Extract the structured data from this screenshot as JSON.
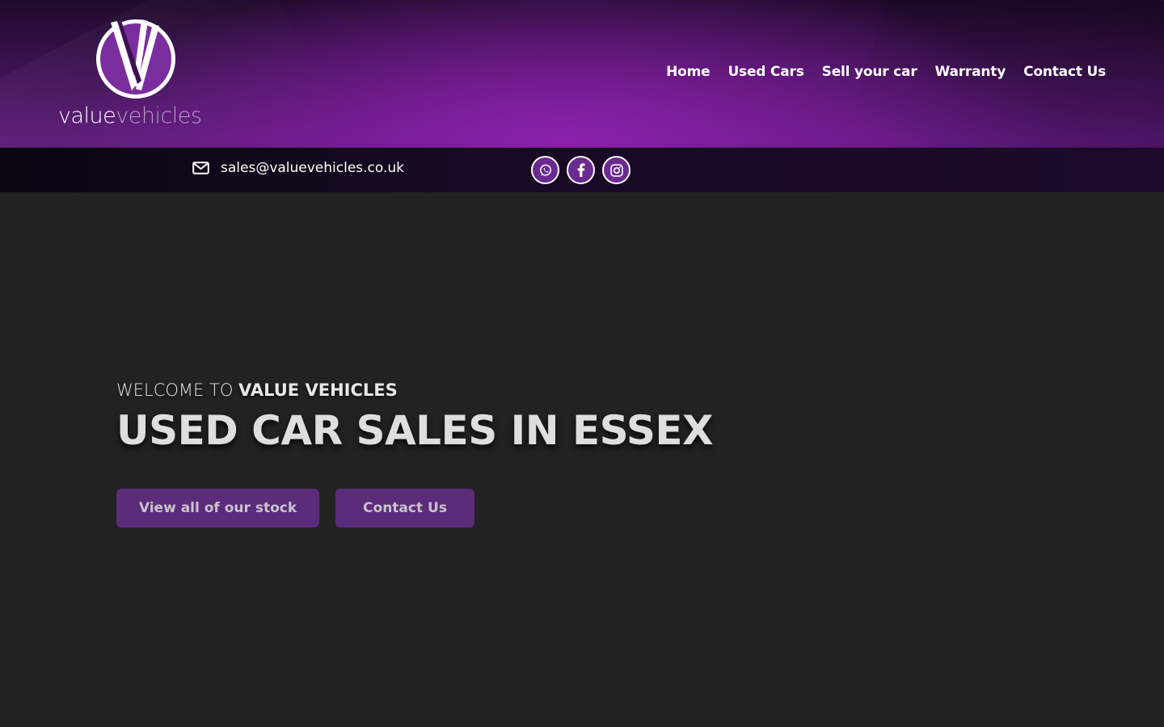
{
  "brand": {
    "logo_word_1": "value",
    "logo_word_2": "vehicles",
    "accent_purple": "#6a2a8f"
  },
  "nav": {
    "items": [
      {
        "label": "Home"
      },
      {
        "label": "Used Cars"
      },
      {
        "label": "Sell your car"
      },
      {
        "label": "Warranty"
      },
      {
        "label": "Contact Us"
      }
    ]
  },
  "topbar": {
    "email": "sales@valuevehicles.co.uk",
    "email_icon": "envelope-icon",
    "socials": [
      {
        "icon": "whatsapp-icon"
      },
      {
        "icon": "facebook-icon"
      },
      {
        "icon": "instagram-icon"
      }
    ]
  },
  "hero": {
    "welcome_prefix": "WELCOME TO",
    "welcome_brand": "VALUE VEHICLES",
    "title": "USED CAR SALES IN ESSEX",
    "buttons": {
      "stock": "View all of our stock",
      "contact": "Contact Us"
    }
  }
}
